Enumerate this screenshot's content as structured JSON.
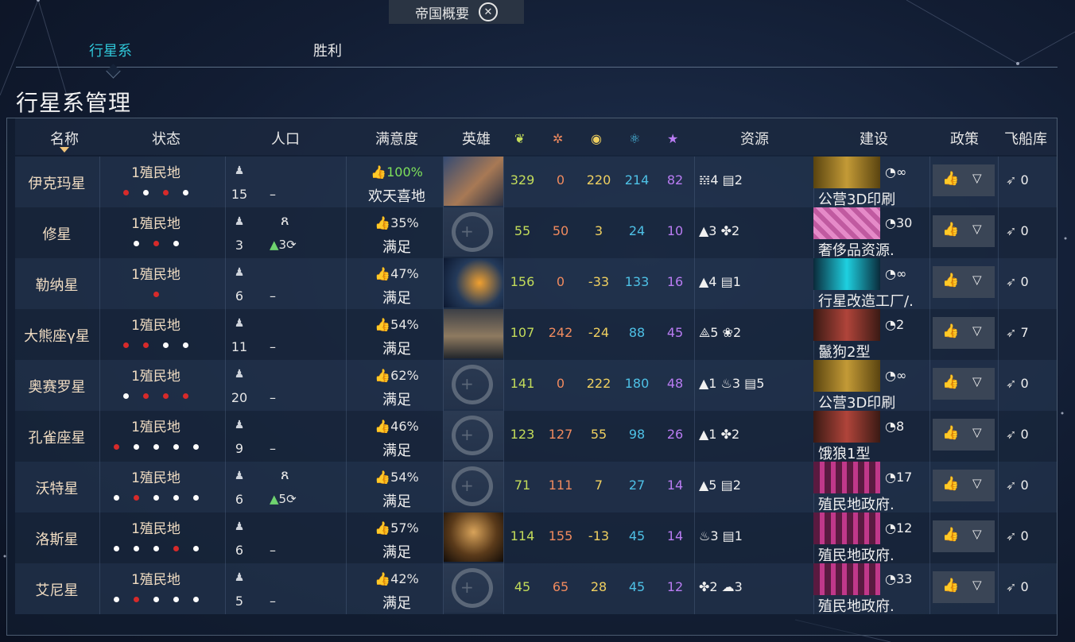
{
  "window": {
    "title": "帝国概要",
    "close_icon": "close-icon"
  },
  "tabs": [
    {
      "label": "行星系",
      "active": true
    },
    {
      "label": "胜利",
      "active": false
    }
  ],
  "page_title": "行星系管理",
  "columns": {
    "name": "名称",
    "status": "状态",
    "population": "人口",
    "satisfaction": "满意度",
    "hero": "英雄",
    "food_icon": "food-icon",
    "industry_icon": "industry-icon",
    "dust_icon": "dust-icon",
    "science_icon": "science-icon",
    "influence_icon": "influence-icon",
    "resources": "资源",
    "construction": "建设",
    "policy": "政策",
    "shipyard": "飞船库"
  },
  "rows": [
    {
      "name": "伊克玛星",
      "status": "1殖民地",
      "dots": [
        "red",
        "white",
        "red",
        "white"
      ],
      "pop": "15",
      "pop_extra": "–",
      "sat_pct": "100%",
      "sat_word": "欢天喜地",
      "sat_green": true,
      "hero": "img1",
      "food": "329",
      "industry": "0",
      "dust": "220",
      "science": "214",
      "influence": "82",
      "resources": "𝍍4  ▤2",
      "build_img": "b-gold",
      "build_turns": "◔∞",
      "build_name": "公营3D印刷",
      "ships": "0"
    },
    {
      "name": "修星",
      "status": "1殖民地",
      "dots": [
        "white",
        "red",
        "white"
      ],
      "pop": "3",
      "pop_species": "ጸ",
      "pop_growth": "▲3⟳",
      "sat_pct": "35%",
      "sat_word": "满足",
      "hero": "empty",
      "food": "55",
      "industry": "50",
      "dust": "3",
      "science": "24",
      "influence": "10",
      "resources": "▲3  ✤2",
      "build_img": "b-pink",
      "build_turns": "◔30",
      "build_name": "奢侈品资源.",
      "ships": "0"
    },
    {
      "name": "勒纳星",
      "status": "1殖民地",
      "dots": [
        "red"
      ],
      "pop": "6",
      "pop_extra": "–",
      "sat_pct": "47%",
      "sat_word": "满足",
      "hero": "img2",
      "food": "156",
      "industry": "0",
      "dust": "-33",
      "science": "133",
      "influence": "16",
      "resources": "▲4  ▤1",
      "build_img": "b-cyan",
      "build_turns": "◔∞",
      "build_name": "行星改造工厂/.",
      "ships": "0"
    },
    {
      "name": "大熊座γ星",
      "status": "1殖民地",
      "dots": [
        "red",
        "red",
        "white",
        "white"
      ],
      "pop": "11",
      "pop_extra": "–",
      "sat_pct": "54%",
      "sat_word": "满足",
      "hero": "img3",
      "food": "107",
      "industry": "242",
      "dust": "-24",
      "science": "88",
      "influence": "45",
      "resources": "⟁5  ❀2",
      "build_img": "b-rust",
      "build_turns": "◔2",
      "build_name": "鬣狗2型",
      "ships": "7"
    },
    {
      "name": "奥赛罗星",
      "status": "1殖民地",
      "dots": [
        "white",
        "red",
        "red",
        "red"
      ],
      "pop": "20",
      "pop_extra": "–",
      "sat_pct": "62%",
      "sat_word": "满足",
      "hero": "empty",
      "food": "141",
      "industry": "0",
      "dust": "222",
      "science": "180",
      "influence": "48",
      "resources": "▲1  ♨3  ▤5",
      "build_img": "b-gold",
      "build_turns": "◔∞",
      "build_name": "公营3D印刷",
      "ships": "0"
    },
    {
      "name": "孔雀座星",
      "status": "1殖民地",
      "dots": [
        "red",
        "white",
        "white",
        "white",
        "white"
      ],
      "pop": "9",
      "pop_extra": "–",
      "sat_pct": "46%",
      "sat_word": "满足",
      "hero": "empty",
      "food": "123",
      "industry": "127",
      "dust": "55",
      "science": "98",
      "influence": "26",
      "resources": "▲1  ✤2",
      "build_img": "b-rust",
      "build_turns": "◔8",
      "build_name": "饿狼1型",
      "ships": "0"
    },
    {
      "name": "沃特星",
      "status": "1殖民地",
      "dots": [
        "white",
        "red",
        "white",
        "white",
        "white"
      ],
      "pop": "6",
      "pop_species": "ጸ",
      "pop_growth": "▲5⟳",
      "sat_pct": "54%",
      "sat_word": "满足",
      "hero": "empty",
      "food": "71",
      "industry": "111",
      "dust": "7",
      "science": "27",
      "influence": "14",
      "resources": "▲5  ▤2",
      "build_img": "b-magenta",
      "build_turns": "◔17",
      "build_name": "殖民地政府.",
      "ships": "0"
    },
    {
      "name": "洛斯星",
      "status": "1殖民地",
      "dots": [
        "white",
        "white",
        "white",
        "red",
        "white"
      ],
      "pop": "6",
      "pop_extra": "–",
      "sat_pct": "57%",
      "sat_word": "满足",
      "hero": "img4",
      "food": "114",
      "industry": "155",
      "dust": "-13",
      "science": "45",
      "influence": "14",
      "resources": "♨3  ▤1",
      "build_img": "b-magenta",
      "build_turns": "◔12",
      "build_name": "殖民地政府.",
      "ships": "0"
    },
    {
      "name": "艾尼星",
      "status": "1殖民地",
      "dots": [
        "white",
        "red",
        "white",
        "white",
        "white"
      ],
      "pop": "5",
      "pop_extra": "–",
      "sat_pct": "42%",
      "sat_word": "满足",
      "hero": "empty",
      "food": "45",
      "industry": "65",
      "dust": "28",
      "science": "45",
      "influence": "12",
      "resources": "✤2  ☁3",
      "build_img": "b-magenta",
      "build_turns": "◔33",
      "build_name": "殖民地政府.",
      "ships": "0"
    }
  ]
}
